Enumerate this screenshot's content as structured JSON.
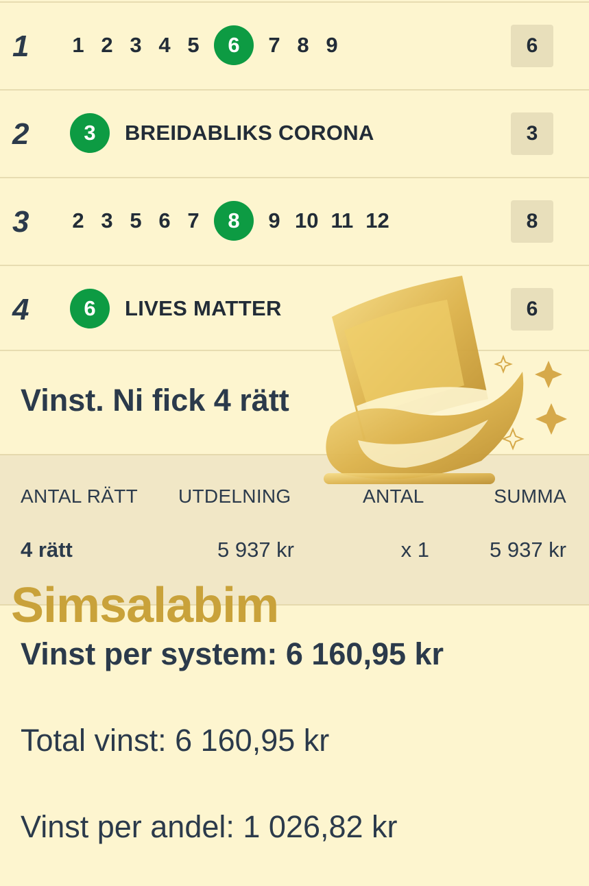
{
  "races": [
    {
      "number": "1",
      "horses": [
        "1",
        "2",
        "3",
        "4",
        "5",
        "6",
        "7",
        "8",
        "9"
      ],
      "winner": "6",
      "winner_name": "",
      "result": "6"
    },
    {
      "number": "2",
      "horses": [
        "3"
      ],
      "winner": "3",
      "winner_name": "BREIDABLIKS CORONA",
      "result": "3"
    },
    {
      "number": "3",
      "horses": [
        "2",
        "3",
        "5",
        "6",
        "7",
        "8",
        "9",
        "10",
        "11",
        "12"
      ],
      "winner": "8",
      "winner_name": "",
      "result": "8"
    },
    {
      "number": "4",
      "horses": [
        "6"
      ],
      "winner": "6",
      "winner_name": "LIVES MATTER",
      "result": "6"
    }
  ],
  "headline": "Vinst. Ni fick 4 rätt",
  "table": {
    "headers": [
      "ANTAL RÄTT",
      "UTDELNING",
      "ANTAL",
      "SUMMA"
    ],
    "rows": [
      {
        "antal_ratt": "4 rätt",
        "utdelning": "5 937 kr",
        "antal": "x 1",
        "summa": "5 937 kr"
      }
    ]
  },
  "brand": "Simsalabim",
  "vinst_per_system": "Vinst per system: 6 160,95 kr",
  "total_vinst": "Total vinst: 6 160,95 kr",
  "vinst_per_andel": "Vinst per andel: 1 026,82 kr",
  "colors": {
    "background": "#fdf5cf",
    "winner_green": "#0d9b43",
    "text": "#2b3a4b",
    "gold": "#c9a23a"
  }
}
